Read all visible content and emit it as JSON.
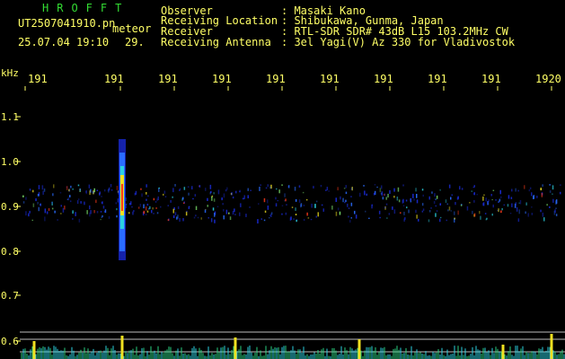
{
  "app_title": "HROFFT",
  "file_name": "UT2507041910.pn",
  "file_tag": "meteor",
  "date_time": "25.07.04 19:10",
  "seconds": "29.",
  "info": [
    {
      "label": "Observer",
      "value": ": Masaki Kano"
    },
    {
      "label": "Receiving Location",
      "value": ": Shibukawa, Gunma, Japan"
    },
    {
      "label": "Receiver",
      "value": ": RTL-SDR SDR# 43dB L15 103.2MHz CW"
    },
    {
      "label": "Receiving Antenna",
      "value": ": 3el Yagi(V) Az 330 for Vladivostok"
    }
  ],
  "time_ticks": [
    "191",
    "191",
    "191",
    "191",
    "191",
    "191",
    "191",
    "191",
    "191",
    "1920"
  ],
  "freq_axis": {
    "unit": "kHz",
    "labels": [
      "1.1",
      "1.0",
      "0.9",
      "0.8",
      "0.7",
      "0.6"
    ]
  },
  "colors": {
    "header_text": "#ffff66",
    "title": "#33dd33",
    "background": "#000000"
  }
}
